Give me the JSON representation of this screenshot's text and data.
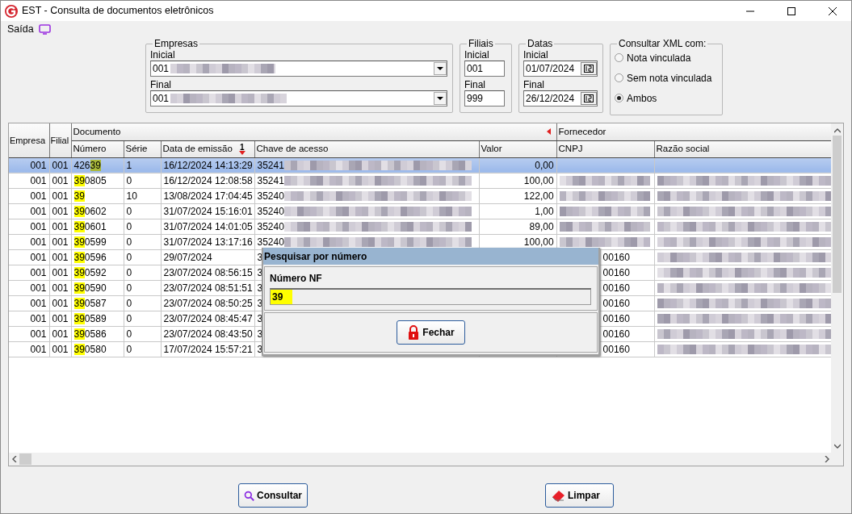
{
  "window": {
    "title": "EST - Consulta de documentos eletrônicos"
  },
  "menu": [
    {
      "label": "Saída"
    }
  ],
  "empresas": {
    "legend": "Empresas",
    "inicial": {
      "label": "Inicial",
      "value": "001",
      "redacted": true
    },
    "final": {
      "label": "Final",
      "value": "001",
      "redacted": true
    }
  },
  "filiais": {
    "legend": "Filiais",
    "inicial": {
      "label": "Inicial",
      "value": "001"
    },
    "final": {
      "label": "Final",
      "value": "999"
    }
  },
  "datas": {
    "legend": "Datas",
    "inicial": {
      "label": "Inicial",
      "value": "01/07/2024"
    },
    "final": {
      "label": "Final",
      "value": "26/12/2024"
    }
  },
  "xml": {
    "legend": "Consultar XML com:",
    "options": [
      {
        "label": "Nota vinculada",
        "selected": false
      },
      {
        "label": "Sem nota vinculada",
        "selected": false
      },
      {
        "label": "Ambos",
        "selected": true
      }
    ]
  },
  "table": {
    "fixed_columns": [
      {
        "label": "Empresa"
      },
      {
        "label": "Filial"
      }
    ],
    "groups": [
      {
        "label": "Documento",
        "collapsible": true,
        "columns": [
          {
            "label": "Número"
          },
          {
            "label": "Série"
          },
          {
            "label": "Data de emissão",
            "sort_rank": "1",
            "sort_descending": true
          },
          {
            "label": "Chave de acesso"
          },
          {
            "label": "Valor"
          }
        ]
      },
      {
        "label": "Fornecedor",
        "collapsible": false,
        "columns": [
          {
            "label": "CNPJ"
          },
          {
            "label": "Razão social"
          }
        ]
      }
    ],
    "rows": [
      {
        "selected": true,
        "empresa": "001",
        "filial": "001",
        "numero": [
          {
            "text": "426",
            "highlight": false
          },
          {
            "text": "39",
            "highlight": true
          }
        ],
        "serie": "1",
        "data": "16/12/2024 14:13:29",
        "chave": {
          "text": "35241",
          "redacted": true
        },
        "valor": "0,00",
        "cnpj": {
          "redacted": false
        },
        "razao": {
          "redacted": false
        }
      },
      {
        "selected": false,
        "empresa": "001",
        "filial": "001",
        "numero": [
          {
            "text": "39",
            "highlight": true
          },
          {
            "text": "0805",
            "highlight": false
          }
        ],
        "serie": "0",
        "data": "16/12/2024 12:08:58",
        "chave": {
          "text": "35241",
          "redacted": true
        },
        "valor": "100,00",
        "cnpj": {
          "redacted": true
        },
        "razao": {
          "redacted": true
        }
      },
      {
        "selected": false,
        "empresa": "001",
        "filial": "001",
        "numero": [
          {
            "text": "39",
            "highlight": true
          }
        ],
        "serie": "10",
        "data": "13/08/2024 17:04:45",
        "chave": {
          "text": "35240",
          "redacted": true
        },
        "valor": "122,00",
        "cnpj": {
          "redacted": true
        },
        "razao": {
          "redacted": true
        }
      },
      {
        "selected": false,
        "empresa": "001",
        "filial": "001",
        "numero": [
          {
            "text": "39",
            "highlight": true
          },
          {
            "text": "0602",
            "highlight": false
          }
        ],
        "serie": "0",
        "data": "31/07/2024 15:16:01",
        "chave": {
          "text": "35240",
          "redacted": true
        },
        "valor": "1,00",
        "cnpj": {
          "redacted": true
        },
        "razao": {
          "redacted": true
        }
      },
      {
        "selected": false,
        "empresa": "001",
        "filial": "001",
        "numero": [
          {
            "text": "39",
            "highlight": true
          },
          {
            "text": "0601",
            "highlight": false
          }
        ],
        "serie": "0",
        "data": "31/07/2024 14:01:05",
        "chave": {
          "text": "35240",
          "redacted": true
        },
        "valor": "89,00",
        "cnpj": {
          "redacted": true
        },
        "razao": {
          "redacted": true
        }
      },
      {
        "selected": false,
        "empresa": "001",
        "filial": "001",
        "numero": [
          {
            "text": "39",
            "highlight": true
          },
          {
            "text": "0599",
            "highlight": false
          }
        ],
        "serie": "0",
        "data": "31/07/2024 13:17:16",
        "chave": {
          "text": "35240",
          "redacted": true
        },
        "valor": "100,00",
        "cnpj": {
          "redacted": true
        },
        "razao": {
          "redacted": true
        }
      },
      {
        "selected": false,
        "empresa": "001",
        "filial": "001",
        "numero": [
          {
            "text": "39",
            "highlight": true
          },
          {
            "text": "0596",
            "highlight": false
          }
        ],
        "serie": "0",
        "data": "29/07/2024",
        "chave": {
          "text": "3"
        },
        "cnpj": {
          "text": "00160",
          "redacted": false
        },
        "razao": {
          "redacted": true
        }
      },
      {
        "selected": false,
        "empresa": "001",
        "filial": "001",
        "numero": [
          {
            "text": "39",
            "highlight": true
          },
          {
            "text": "0592",
            "highlight": false
          }
        ],
        "serie": "0",
        "data": "23/07/2024 08:56:15",
        "chave": {
          "text": "3"
        },
        "cnpj": {
          "text": "00160",
          "redacted": false
        },
        "razao": {
          "redacted": true
        }
      },
      {
        "selected": false,
        "empresa": "001",
        "filial": "001",
        "numero": [
          {
            "text": "39",
            "highlight": true
          },
          {
            "text": "0590",
            "highlight": false
          }
        ],
        "serie": "0",
        "data": "23/07/2024 08:51:51",
        "chave": {
          "text": "3"
        },
        "cnpj": {
          "text": "00160",
          "redacted": false
        },
        "razao": {
          "redacted": true
        }
      },
      {
        "selected": false,
        "empresa": "001",
        "filial": "001",
        "numero": [
          {
            "text": "39",
            "highlight": true
          },
          {
            "text": "0587",
            "highlight": false
          }
        ],
        "serie": "0",
        "data": "23/07/2024 08:50:25",
        "chave": {
          "text": "3"
        },
        "cnpj": {
          "text": "00160",
          "redacted": false
        },
        "razao": {
          "redacted": true
        }
      },
      {
        "selected": false,
        "empresa": "001",
        "filial": "001",
        "numero": [
          {
            "text": "39",
            "highlight": true
          },
          {
            "text": "0589",
            "highlight": false
          }
        ],
        "serie": "0",
        "data": "23/07/2024 08:45:47",
        "chave": {
          "text": "3"
        },
        "cnpj": {
          "text": "00160",
          "redacted": false
        },
        "razao": {
          "redacted": true
        }
      },
      {
        "selected": false,
        "empresa": "001",
        "filial": "001",
        "numero": [
          {
            "text": "39",
            "highlight": true
          },
          {
            "text": "0586",
            "highlight": false
          }
        ],
        "serie": "0",
        "data": "23/07/2024 08:43:50",
        "chave": {
          "text": "3"
        },
        "cnpj": {
          "text": "00160",
          "redacted": false
        },
        "razao": {
          "redacted": true
        }
      },
      {
        "selected": false,
        "empresa": "001",
        "filial": "001",
        "numero": [
          {
            "text": "39",
            "highlight": true
          },
          {
            "text": "0580",
            "highlight": false
          }
        ],
        "serie": "0",
        "data": "17/07/2024 15:57:21",
        "chave": {
          "text": "3"
        },
        "cnpj": {
          "text": "00160",
          "redacted": false
        },
        "razao": {
          "redacted": true
        }
      }
    ]
  },
  "dialog": {
    "title": "Pesquisar por número",
    "field_label": "Número NF",
    "value": "39",
    "value_highlight": true,
    "button": "Fechar"
  },
  "buttons": [
    {
      "label": "Consultar",
      "kind": "search"
    },
    {
      "label": "Limpar",
      "kind": "clear"
    }
  ]
}
